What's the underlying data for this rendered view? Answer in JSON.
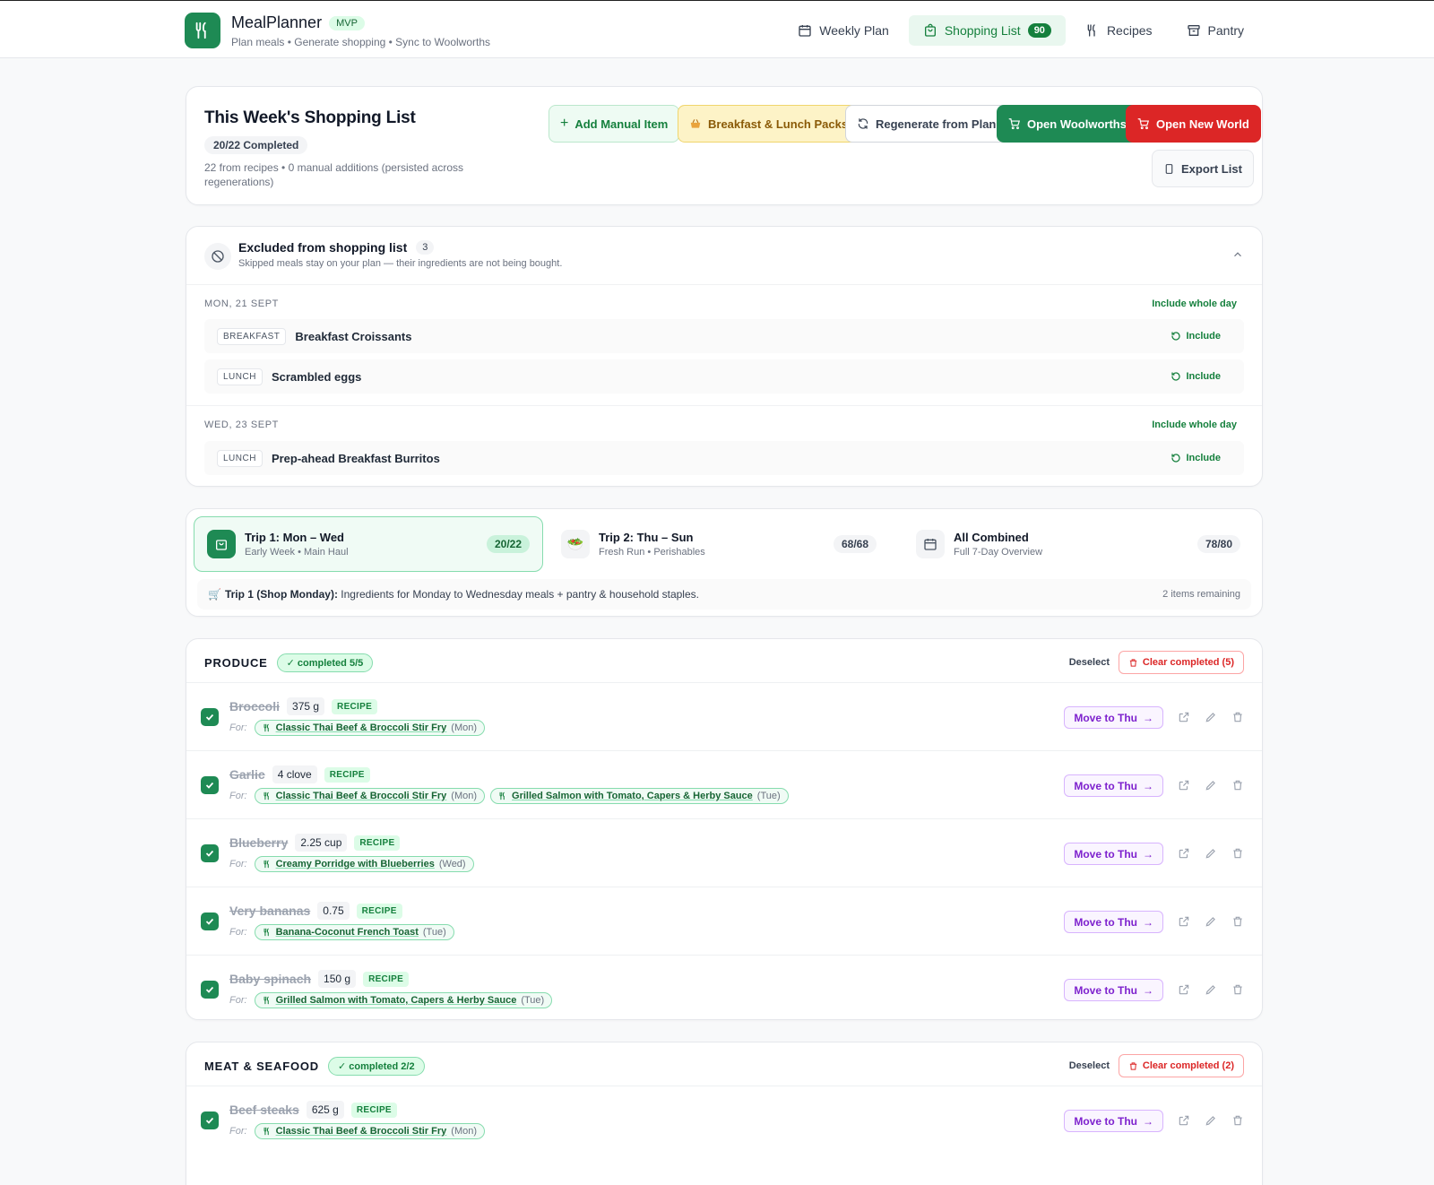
{
  "app": {
    "title": "MealPlanner",
    "badge": "MVP",
    "subtitle": "Plan meals • Generate shopping • Sync to Woolworths"
  },
  "nav": {
    "items": [
      {
        "label": "Weekly Plan",
        "icon": "calendar-icon"
      },
      {
        "label": "Shopping List",
        "icon": "shopping-bag-icon",
        "badge": "90",
        "active": true
      },
      {
        "label": "Recipes",
        "icon": "utensils-icon"
      },
      {
        "label": "Pantry",
        "icon": "pantry-icon"
      }
    ]
  },
  "shopping": {
    "title": "This Week's Shopping List",
    "progress_badge": "20/22 Completed",
    "description": "22 from recipes • 0 manual additions (persisted across regenerations)",
    "buttons": {
      "add_manual": "Add Manual Item",
      "packs": "Breakfast & Lunch Packs",
      "regenerate": "Regenerate from Plan",
      "woolworths": "Open Woolworths",
      "new_world": "Open New World",
      "export": "Export List"
    }
  },
  "excluded": {
    "title": "Excluded from shopping list",
    "count": "3",
    "subtitle": "Skipped meals stay on your plan — their ingredients are not being bought.",
    "include_day_label": "Include whole day",
    "include_label": "Include",
    "days": [
      {
        "label": "MON, 21 SEPT",
        "meals": [
          {
            "type": "BREAKFAST",
            "name": "Breakfast Croissants"
          },
          {
            "type": "LUNCH",
            "name": "Scrambled eggs"
          }
        ]
      },
      {
        "label": "WED, 23 SEPT",
        "meals": [
          {
            "type": "LUNCH",
            "name": "Prep-ahead Breakfast Burritos"
          }
        ]
      }
    ]
  },
  "trips": {
    "items": [
      {
        "name": "Trip 1: Mon – Wed",
        "sub": "Early Week • Main Haul",
        "count": "20/22",
        "active": true,
        "icon": "shopping-bag-icon"
      },
      {
        "name": "Trip 2: Thu – Sun",
        "sub": "Fresh Run • Perishables",
        "count": "68/68",
        "icon": "salad-bowl-icon",
        "glyph": "🥗"
      },
      {
        "name": "All Combined",
        "sub": "Full 7-Day Overview",
        "count": "78/80",
        "icon": "calendar-icon"
      }
    ],
    "note_icon": "🛒",
    "note_bold": "Trip 1 (Shop Monday):",
    "note_text": " Ingredients for Monday to Wednesday meals + pantry & household staples.",
    "remaining": "2 items remaining"
  },
  "common": {
    "for_label": "For:",
    "deselect": "Deselect",
    "move_label": "Move to Thu"
  },
  "categories": [
    {
      "name": "PRODUCE",
      "completed": "✓ completed 5/5",
      "clear": "Clear completed (5)",
      "items": [
        {
          "name": "Broccoli",
          "qty": "375 g",
          "source": "RECIPE",
          "recipes": [
            {
              "name": "Classic Thai Beef & Broccoli Stir Fry",
              "day": "(Mon)"
            }
          ]
        },
        {
          "name": "Garlic",
          "qty": "4 clove",
          "source": "RECIPE",
          "recipes": [
            {
              "name": "Classic Thai Beef & Broccoli Stir Fry",
              "day": "(Mon)"
            },
            {
              "name": "Grilled Salmon with Tomato, Capers & Herby Sauce",
              "day": "(Tue)"
            }
          ]
        },
        {
          "name": "Blueberry",
          "qty": "2.25 cup",
          "source": "RECIPE",
          "recipes": [
            {
              "name": "Creamy Porridge with Blueberries",
              "day": "(Wed)"
            }
          ]
        },
        {
          "name": "Very bananas",
          "qty": "0.75",
          "source": "RECIPE",
          "recipes": [
            {
              "name": "Banana-Coconut French Toast",
              "day": "(Tue)"
            }
          ]
        },
        {
          "name": "Baby spinach",
          "qty": "150 g",
          "source": "RECIPE",
          "recipes": [
            {
              "name": "Grilled Salmon with Tomato, Capers & Herby Sauce",
              "day": "(Tue)"
            }
          ]
        }
      ]
    },
    {
      "name": "MEAT & SEAFOOD",
      "completed": "✓ completed 2/2",
      "clear": "Clear completed (2)",
      "items": [
        {
          "name": "Beef steaks",
          "qty": "625 g",
          "source": "RECIPE",
          "recipes": [
            {
              "name": "Classic Thai Beef & Broccoli Stir Fry",
              "day": "(Mon)"
            }
          ]
        }
      ]
    }
  ],
  "colors": {
    "brand_green": "#1e8a54",
    "danger_red": "#dc2626",
    "move_purple": "#7e22ce"
  }
}
